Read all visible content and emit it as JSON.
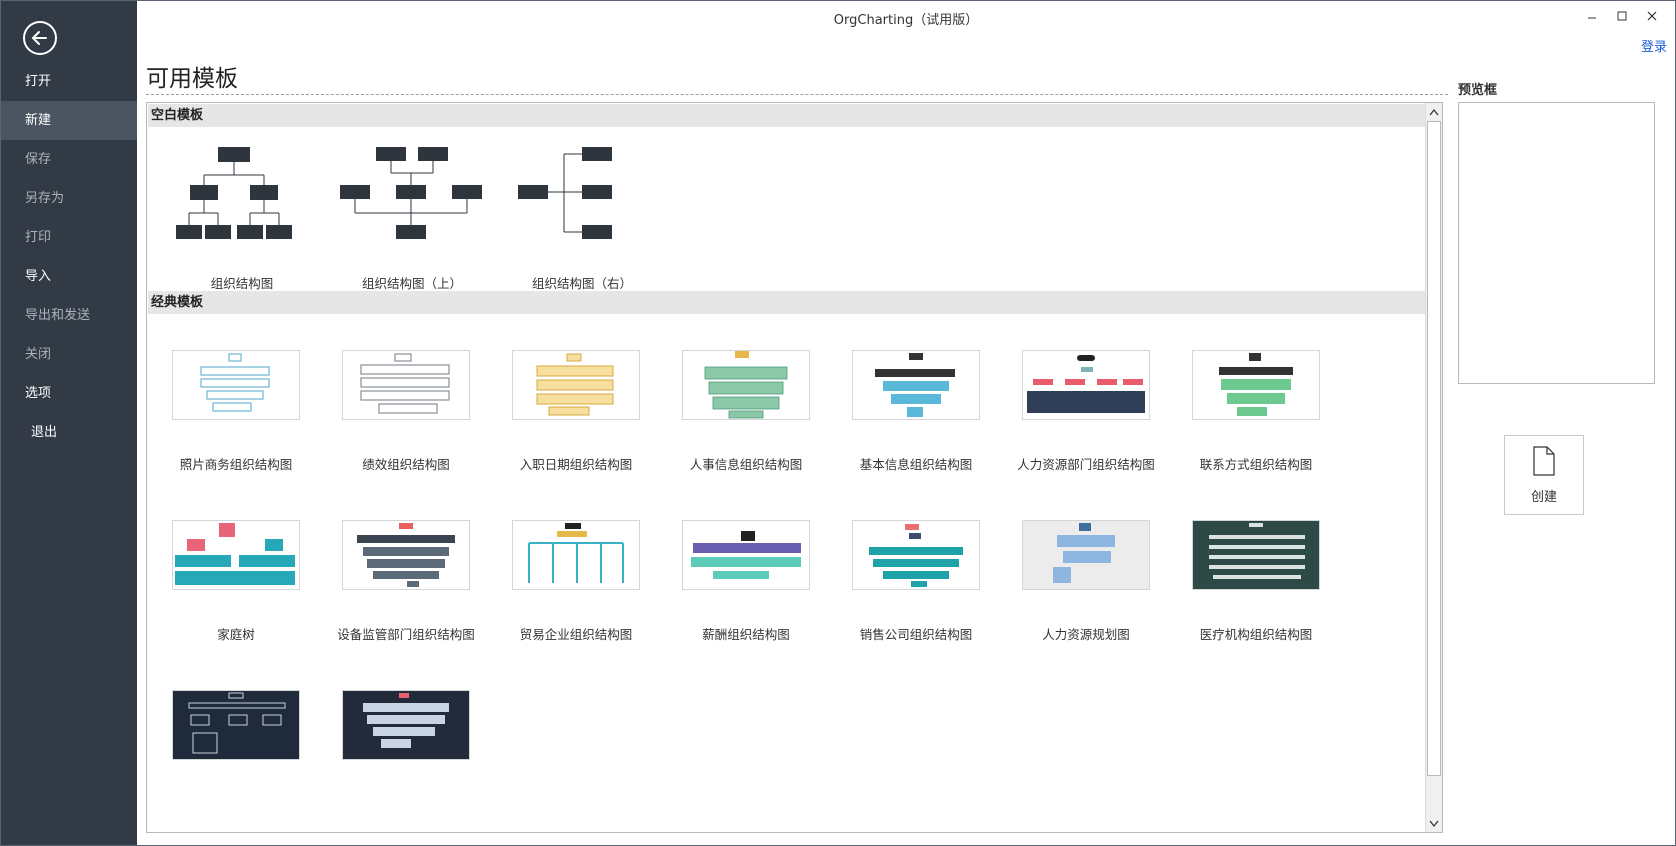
{
  "window": {
    "title": "OrgCharting（试用版）",
    "login": "登录"
  },
  "sidebar": {
    "items": [
      {
        "label": "打开"
      },
      {
        "label": "新建"
      },
      {
        "label": "保存"
      },
      {
        "label": "另存为"
      },
      {
        "label": "打印"
      },
      {
        "label": "导入"
      },
      {
        "label": "导出和发送"
      },
      {
        "label": "关闭"
      },
      {
        "label": "选项"
      },
      {
        "label": "退出"
      }
    ]
  },
  "main": {
    "heading": "可用模板",
    "sections": [
      {
        "title": "空白模板",
        "templates": [
          {
            "label": "组织结构图"
          },
          {
            "label": "组织结构图（上）"
          },
          {
            "label": "组织结构图（右）"
          }
        ]
      },
      {
        "title": "经典模板",
        "templates": [
          {
            "label": "照片商务组织结构图"
          },
          {
            "label": "绩效组织结构图"
          },
          {
            "label": "入职日期组织结构图"
          },
          {
            "label": "人事信息组织结构图"
          },
          {
            "label": "基本信息组织结构图"
          },
          {
            "label": "人力资源部门组织结构图"
          },
          {
            "label": "联系方式组织结构图"
          },
          {
            "label": "家庭树"
          },
          {
            "label": "设备监管部门组织结构图"
          },
          {
            "label": "贸易企业组织结构图"
          },
          {
            "label": "薪酬组织结构图"
          },
          {
            "label": "销售公司组织结构图"
          },
          {
            "label": "人力资源规划图"
          },
          {
            "label": "医疗机构组织结构图"
          },
          {
            "label": ""
          },
          {
            "label": ""
          }
        ]
      }
    ]
  },
  "preview": {
    "label": "预览框",
    "create_label": "创建"
  },
  "colors": {
    "sidebar_bg": "#323a45",
    "sidebar_active": "#4b5461",
    "node_dark": "#2f353d",
    "link_blue": "#1a5fd6"
  }
}
